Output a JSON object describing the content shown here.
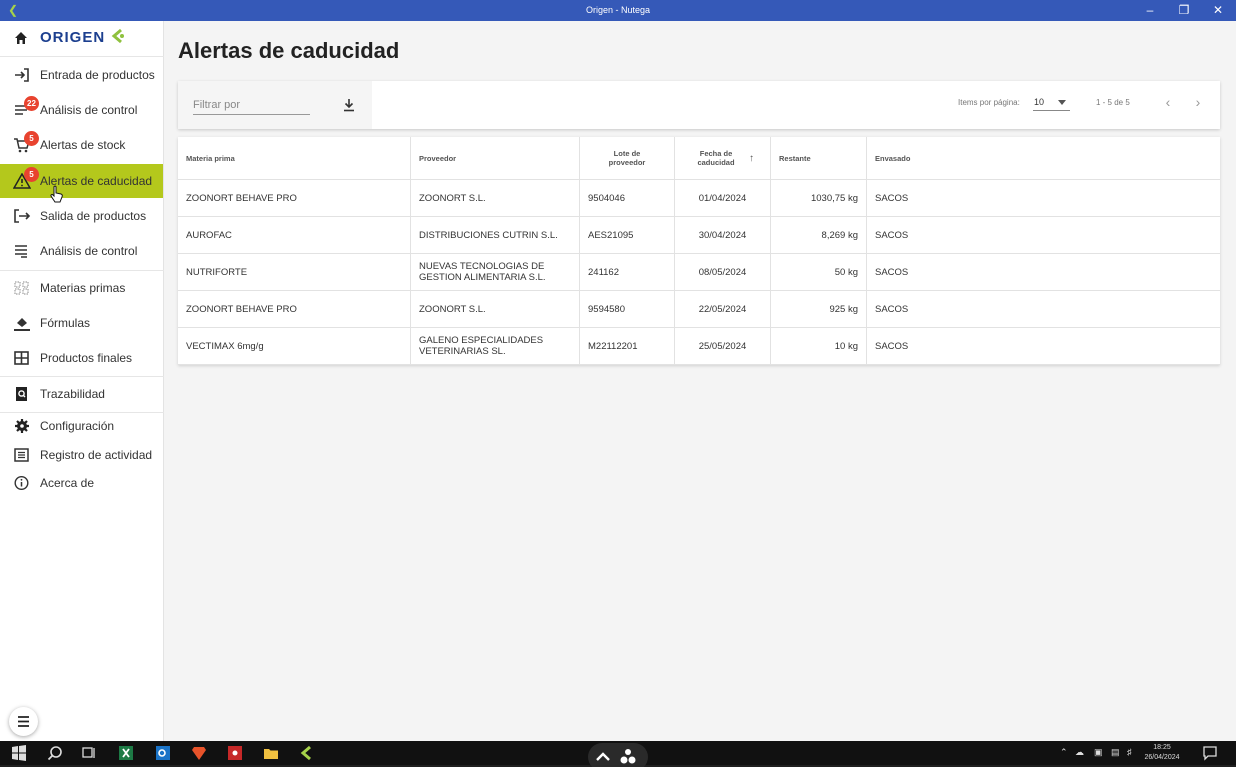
{
  "window": {
    "title": "Origen - Nutega"
  },
  "sidebar": {
    "brand": "ORIGEN",
    "items": [
      {
        "label": "Entrada de productos",
        "icon": "login-arrow-icon",
        "badge": ""
      },
      {
        "label": "Análisis de control",
        "icon": "list-icon",
        "badge": "22"
      },
      {
        "label": "Alertas de stock",
        "icon": "cart-icon",
        "badge": "5"
      },
      {
        "label": "Alertas de caducidad",
        "icon": "warning-icon",
        "badge": "5",
        "active": true
      },
      {
        "label": "Salida de productos",
        "icon": "logout-arrow-icon",
        "badge": ""
      },
      {
        "label": "Análisis de control",
        "icon": "list-icon",
        "badge": ""
      },
      {
        "label": "Materias primas",
        "icon": "grid-dots-icon",
        "badge": ""
      },
      {
        "label": "Fórmulas",
        "icon": "paint-bucket-icon",
        "badge": ""
      },
      {
        "label": "Productos finales",
        "icon": "grid-icon",
        "badge": ""
      },
      {
        "label": "Trazabilidad",
        "icon": "document-search-icon",
        "badge": ""
      },
      {
        "label": "Configuración",
        "icon": "gear-icon",
        "badge": ""
      },
      {
        "label": "Registro de actividad",
        "icon": "table-icon",
        "badge": ""
      },
      {
        "label": "Acerca de",
        "icon": "info-icon",
        "badge": ""
      }
    ]
  },
  "page": {
    "title": "Alertas de caducidad"
  },
  "toolbar": {
    "filter_placeholder": "Filtrar por",
    "items_per_page_label": "Items por página:",
    "items_per_page_value": "10",
    "range": "1 - 5 de 5"
  },
  "table": {
    "headers": [
      "Materia prima",
      "Proveedor",
      "Lote de proveedor",
      "Fecha de caducidad",
      "Restante",
      "Envasado"
    ],
    "rows": [
      [
        "ZOONORT BEHAVE PRO",
        "ZOONORT S.L.",
        "9504046",
        "01/04/2024",
        "1030,75 kg",
        "SACOS"
      ],
      [
        "AUROFAC",
        "DISTRIBUCIONES CUTRIN S.L.",
        "AES21095",
        "30/04/2024",
        "8,269 kg",
        "SACOS"
      ],
      [
        "NUTRIFORTE",
        "NUEVAS TECNOLOGIAS DE GESTION ALIMENTARIA S.L.",
        "241162",
        "08/05/2024",
        "50 kg",
        "SACOS"
      ],
      [
        "ZOONORT BEHAVE PRO",
        "ZOONORT S.L.",
        "9594580",
        "22/05/2024",
        "925 kg",
        "SACOS"
      ],
      [
        "VECTIMAX 6mg/g",
        "GALENO ESPECIALIDADES VETERINARIAS SL.",
        "M22112201",
        "25/05/2024",
        "10 kg",
        "SACOS"
      ]
    ]
  },
  "taskbar": {
    "time": "18:25",
    "date": "26/04/2024"
  },
  "colors": {
    "accent": "#b4c81c",
    "titlebar": "#3559b8",
    "badge": "#e8432f",
    "brand": "#1c3f8f"
  }
}
